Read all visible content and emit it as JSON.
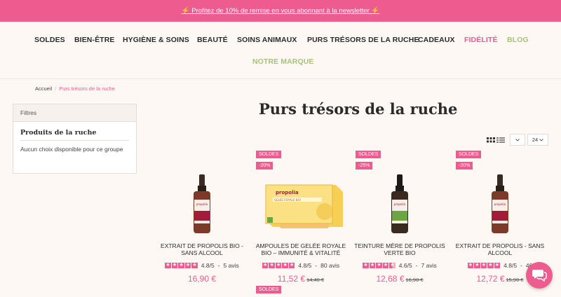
{
  "promo": {
    "text": "⚡ Profitez de 10% de remise en vous abonnant à la newsletter ⚡"
  },
  "nav": {
    "items": [
      "SOLDES",
      "BIEN-ÊTRE",
      "HYGIÈNE & SOINS",
      "BEAUTÉ",
      "SOINS ANIMAUX",
      "PURS TRÉSORS DE LA RUCHE",
      "CADEAUX",
      "FIDÉLITÉ",
      "BLOG",
      "NOTRE MARQUE"
    ],
    "colors": {
      "pink": "#ee5b8f",
      "green": "#a6c27a"
    }
  },
  "breadcrumb": {
    "home": "Accueil",
    "sep": "/",
    "current": "Purs trésors de la ruche"
  },
  "filters": {
    "header": "Filtres",
    "title": "Produits de la ruche",
    "empty": "Aucun choix disponible pour ce groupe"
  },
  "page": {
    "title": "Purs trésors de la ruche"
  },
  "toolbar": {
    "sort_icon": "chevron-down-icon",
    "per_page": "24"
  },
  "products": [
    {
      "name": "Extrait de propolis bio - sans alcool",
      "rating": "4.8/5",
      "reviews": "5 avis",
      "price": "16,90 €",
      "old_price": "",
      "badges": []
    },
    {
      "name": "Ampoules de gelée royale bio – Immunité & Vitalité",
      "rating": "4.8/5",
      "reviews": "80 avis",
      "price": "11,52 €",
      "old_price": "14,40 €",
      "badges": [
        "SOLDES",
        "-20%"
      ]
    },
    {
      "name": "Teinture mère de propolis verte bio",
      "rating": "4.6/5",
      "reviews": "7 avis",
      "price": "12,68 €",
      "old_price": "16,90 €",
      "badges": [
        "SOLDES",
        "-25%"
      ]
    },
    {
      "name": "Extrait de propolis - sans alcool",
      "rating": "4.8/5",
      "reviews": "46",
      "price": "12,72 €",
      "old_price": "15,90 €",
      "badges": [
        "SOLDES",
        "-20%"
      ]
    }
  ],
  "extra_badge": "SOLDES",
  "review_sep": "-"
}
